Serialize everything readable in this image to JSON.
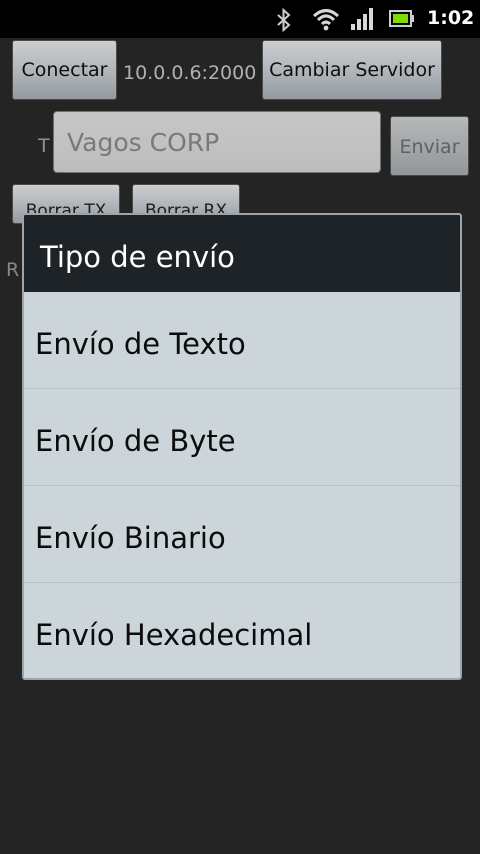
{
  "status_bar": {
    "time": "1:02",
    "icons": [
      "bluetooth-icon",
      "wifi-icon",
      "signal-icon",
      "battery-icon"
    ],
    "battery_color": "#7fdc00"
  },
  "app": {
    "connect_button": "Conectar",
    "server_address": "10.0.0.6:2000",
    "change_server_button": "Cambiar Servidor",
    "tx_label": "T",
    "text_input_value": "Vagos CORP",
    "send_button": "Enviar",
    "clear_tx_button": "Borrar TX",
    "clear_rx_button": "Borrar RX",
    "rx_label": "R"
  },
  "dialog": {
    "title": "Tipo de envío",
    "options": [
      "Envío de Texto",
      "Envío de Byte",
      "Envío Binario",
      "Envío Hexadecimal"
    ]
  }
}
